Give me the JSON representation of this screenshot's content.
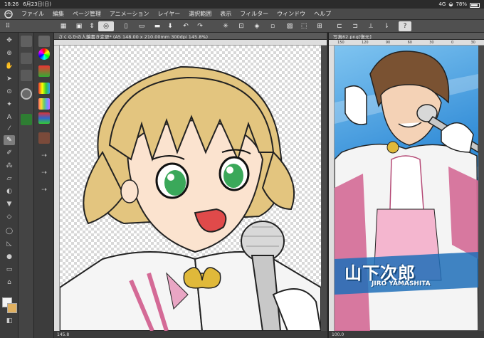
{
  "status": {
    "time": "18:26",
    "date": "6月23日(日)",
    "signal": "4G",
    "battery": "78%"
  },
  "menu": [
    "ファイル",
    "編集",
    "ページ管理",
    "アニメーション",
    "レイヤー",
    "選択範囲",
    "表示",
    "フィルター",
    "ウィンドウ",
    "ヘルプ"
  ],
  "help_label": "?",
  "left_doc": {
    "tab_title": "さくらかの人鏡書き変更* (A5 148.00 x 210.00mm 300dpi 145.8%)",
    "zoom": "145.8"
  },
  "right_doc": {
    "tab_title": "写真62.png[復元]",
    "zoom": "100.0",
    "ruler_ticks": [
      "150",
      "120",
      "90",
      "60",
      "30",
      "0",
      "30",
      "60",
      "90"
    ],
    "card_name_kanji": "山下次郎",
    "card_name_roman": "JIRO YAMASHITA"
  },
  "colors": {
    "ui_dark": "#3a3a3a",
    "hair_blonde": "#e3c57f",
    "eye_green": "#3aa85a",
    "bow_gold": "#e0b93a",
    "uniform_pink": "#d46a96",
    "card_blue": "#2f8ad6"
  }
}
